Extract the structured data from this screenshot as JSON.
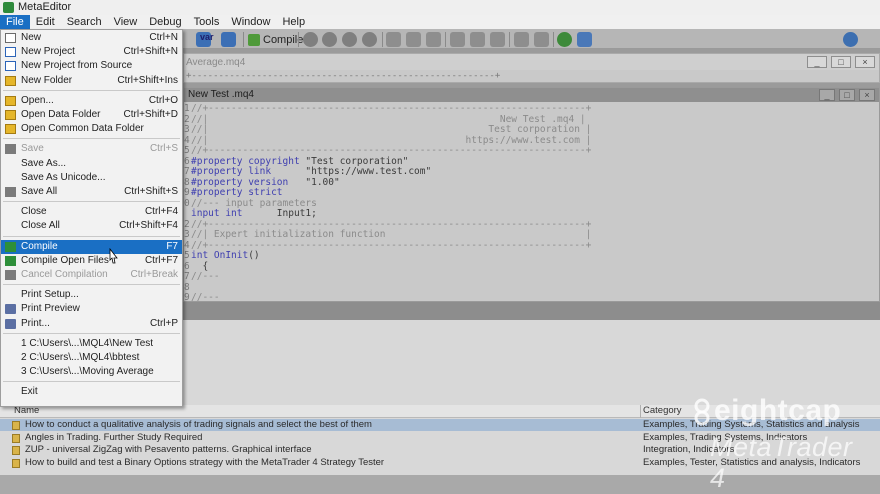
{
  "app": {
    "title": "MetaEditor"
  },
  "menubar": [
    "File",
    "Edit",
    "Search",
    "View",
    "Debug",
    "Tools",
    "Window",
    "Help"
  ],
  "toolbar": {
    "compile_label": "Compile",
    "var_label": "var"
  },
  "windows": [
    {
      "title": "Average.mq4",
      "code_line": "+--------------------------------------------------------+"
    },
    {
      "title": "New Test .mq4"
    }
  ],
  "editor": {
    "lines": [
      {
        "n": "1",
        "text": "//+------------------------------------------------------------------+",
        "cls": "cm"
      },
      {
        "n": "2",
        "text": "//|                                                   New Test .mq4 |",
        "cls": "cm"
      },
      {
        "n": "3",
        "text": "//|                                                 Test corporation |",
        "cls": "cm"
      },
      {
        "n": "4",
        "text": "//|                                             https://www.test.com |",
        "cls": "cm"
      },
      {
        "n": "5",
        "text": "//+------------------------------------------------------------------+",
        "cls": "cm"
      },
      {
        "n": "6",
        "kw": "#property copyright",
        "str": " \"Test corporation\""
      },
      {
        "n": "7",
        "kw": "#property link     ",
        "str": " \"https://www.test.com\""
      },
      {
        "n": "8",
        "kw": "#property version  ",
        "str": " \"1.00\""
      },
      {
        "n": "9",
        "kw": "#property strict",
        "str": ""
      },
      {
        "n": "0",
        "text": "//--- input parameters",
        "cls": "cm"
      },
      {
        "n": "",
        "kw": "input int",
        "str": "      Input1;"
      },
      {
        "n": "2",
        "text": "//+------------------------------------------------------------------+",
        "cls": "cm"
      },
      {
        "n": "3",
        "text": "//| Expert initialization function                                   |",
        "cls": "cm"
      },
      {
        "n": "4",
        "text": "//+------------------------------------------------------------------+",
        "cls": "cm"
      },
      {
        "n": "5",
        "kw": "int OnInit",
        "str": "()"
      },
      {
        "n": "6",
        "text": "  {",
        "cls": "txt"
      },
      {
        "n": "7",
        "text": "//---",
        "cls": "cm"
      },
      {
        "n": "8",
        "text": "",
        "cls": "txt"
      },
      {
        "n": "9",
        "text": "//---",
        "cls": "cm"
      }
    ]
  },
  "file_menu": {
    "items": [
      {
        "label": "New",
        "shortcut": "Ctrl+N",
        "icon": "new-document-icon",
        "ic": "doc"
      },
      {
        "label": "New Project",
        "shortcut": "Ctrl+Shift+N",
        "icon": "new-project-icon",
        "ic": "proj"
      },
      {
        "label": "New Project from Source",
        "shortcut": "",
        "icon": "project-source-icon",
        "ic": "proj"
      },
      {
        "label": "New Folder",
        "shortcut": "Ctrl+Shift+Ins",
        "icon": "new-folder-icon",
        "ic": "folder"
      },
      {
        "sep": true
      },
      {
        "label": "Open...",
        "shortcut": "Ctrl+O",
        "icon": "open-folder-icon",
        "ic": "folder"
      },
      {
        "label": "Open Data Folder",
        "shortcut": "Ctrl+Shift+D",
        "icon": "data-folder-icon",
        "ic": "folder"
      },
      {
        "label": "Open Common Data Folder",
        "shortcut": "",
        "icon": "common-folder-icon",
        "ic": "folder"
      },
      {
        "sep": true
      },
      {
        "label": "Save",
        "shortcut": "Ctrl+S",
        "icon": "save-icon",
        "ic": "save",
        "disabled": true
      },
      {
        "label": "Save As...",
        "shortcut": "",
        "icon": "",
        "ic": ""
      },
      {
        "label": "Save As Unicode...",
        "shortcut": "",
        "icon": "",
        "ic": ""
      },
      {
        "label": "Save All",
        "shortcut": "Ctrl+Shift+S",
        "icon": "save-all-icon",
        "ic": "save"
      },
      {
        "sep": true
      },
      {
        "label": "Close",
        "shortcut": "Ctrl+F4",
        "icon": "",
        "ic": ""
      },
      {
        "label": "Close All",
        "shortcut": "Ctrl+Shift+F4",
        "icon": "",
        "ic": ""
      },
      {
        "sep": true
      },
      {
        "label": "Compile",
        "shortcut": "F7",
        "icon": "compile-icon",
        "ic": "compile",
        "highlight": true
      },
      {
        "label": "Compile Open Files",
        "shortcut": "Ctrl+F7",
        "icon": "compile-files-icon",
        "ic": "compile"
      },
      {
        "label": "Cancel Compilation",
        "shortcut": "Ctrl+Break",
        "icon": "cancel-icon",
        "ic": "save",
        "disabled": true
      },
      {
        "sep": true
      },
      {
        "label": "Print Setup...",
        "shortcut": "",
        "icon": "",
        "ic": ""
      },
      {
        "label": "Print Preview",
        "shortcut": "",
        "icon": "print-preview-icon",
        "ic": "print"
      },
      {
        "label": "Print...",
        "shortcut": "Ctrl+P",
        "icon": "print-icon",
        "ic": "print"
      },
      {
        "sep": true
      },
      {
        "label": "1 C:\\Users\\...\\MQL4\\New Test",
        "shortcut": "",
        "icon": "",
        "ic": ""
      },
      {
        "label": "2 C:\\Users\\...\\MQL4\\bbtest",
        "shortcut": "",
        "icon": "",
        "ic": ""
      },
      {
        "label": "3 C:\\Users\\...\\Moving Average",
        "shortcut": "",
        "icon": "",
        "ic": ""
      },
      {
        "sep": true
      },
      {
        "label": "Exit",
        "shortcut": "",
        "icon": "",
        "ic": ""
      }
    ]
  },
  "articles": {
    "headers": {
      "name": "Name",
      "category": "Category"
    },
    "rows": [
      {
        "name": "How to conduct a qualitative analysis of trading signals and select the best of them",
        "category": "Examples, Trading Systems, Statistics and analysis",
        "selected": true
      },
      {
        "name": "Angles in Trading. Further Study Required",
        "category": "Examples, Trading Systems, Indicators"
      },
      {
        "name": "ZUP - universal ZigZag with Pesavento patterns. Graphical interface",
        "category": "Integration, Indicators"
      },
      {
        "name": "How to build and test a Binary Options strategy with the MetaTrader 4 Strategy Tester",
        "category": "Examples, Tester, Statistics and analysis, Indicators"
      }
    ]
  },
  "watermark": {
    "brand": "eightcap",
    "product": "MetaTrader 4"
  }
}
